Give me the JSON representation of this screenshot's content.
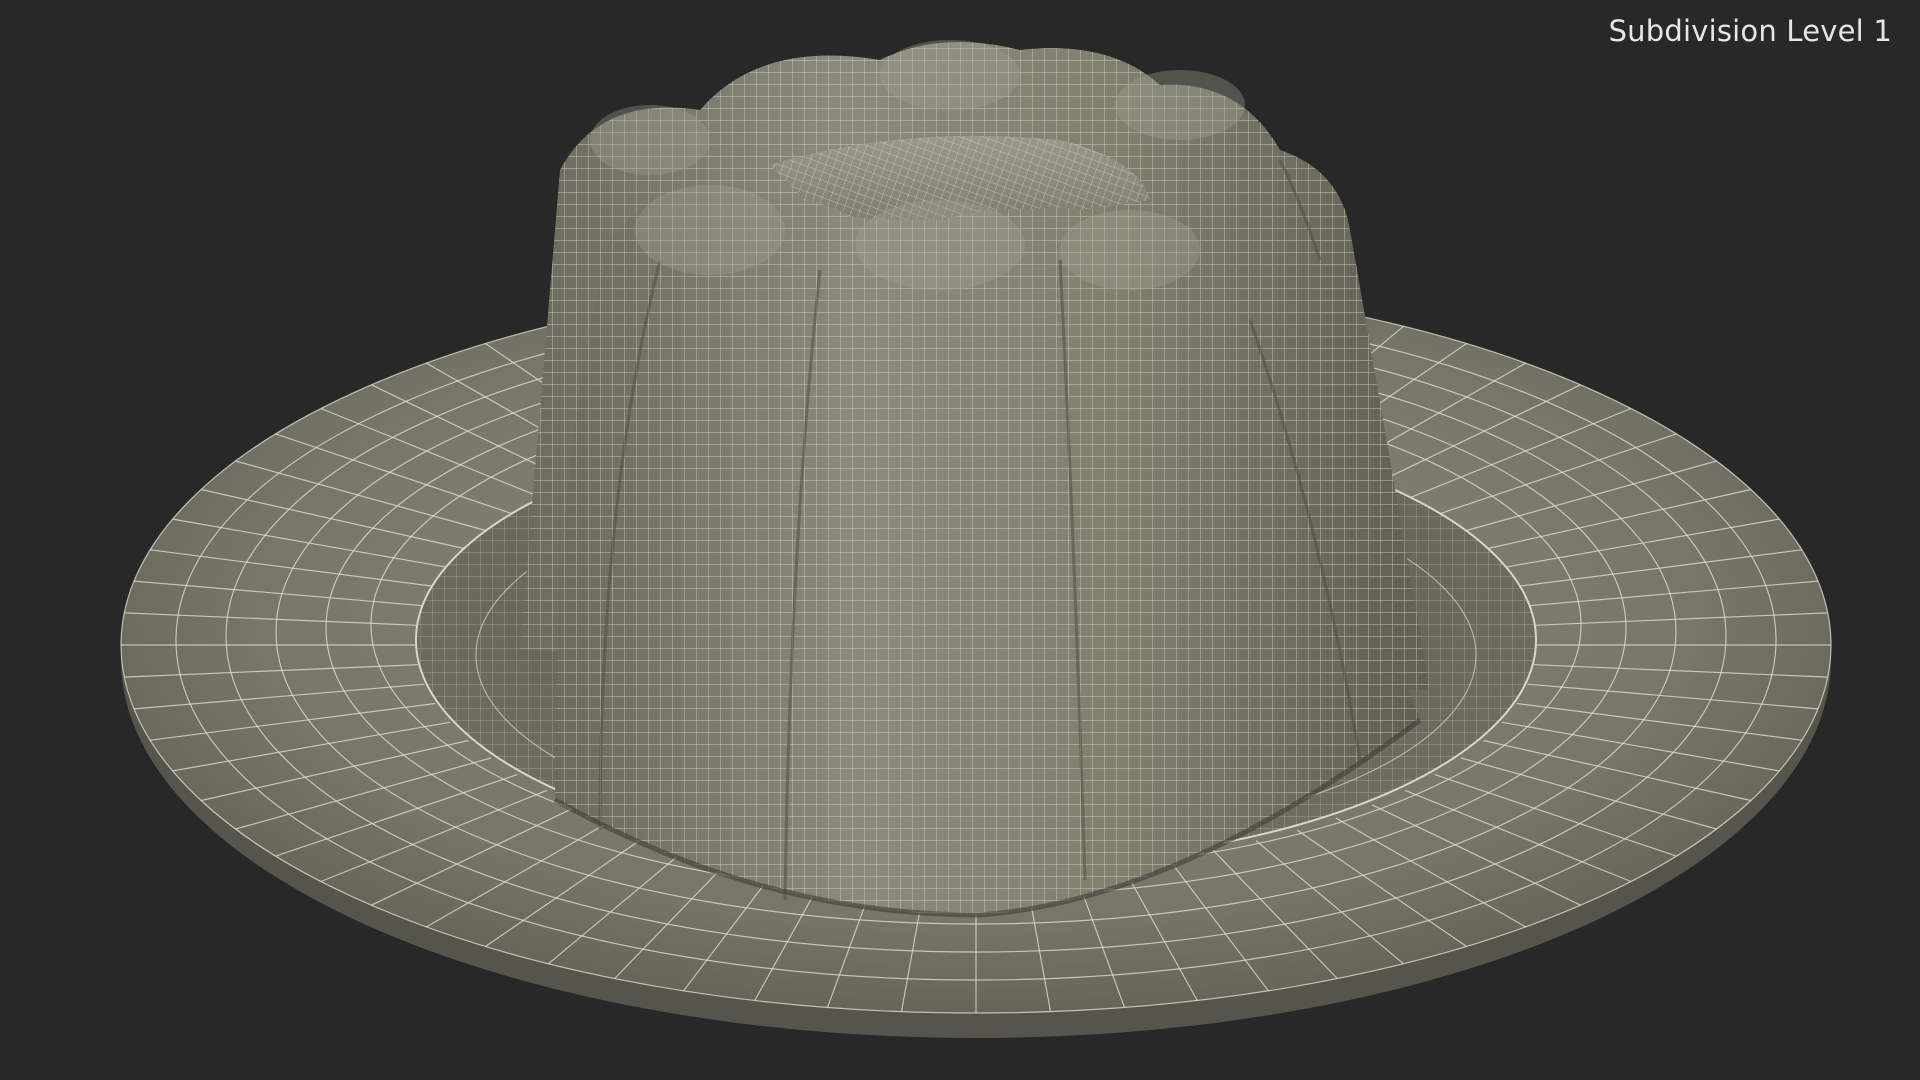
{
  "viewport": {
    "overlay_label": "Subdivision Level 1",
    "background_color": "#282828",
    "mesh_color": "#7a7a6c",
    "wire_color": "#e4e2d2"
  },
  "scene": {
    "object": "wireframe-pudding-on-plate"
  }
}
